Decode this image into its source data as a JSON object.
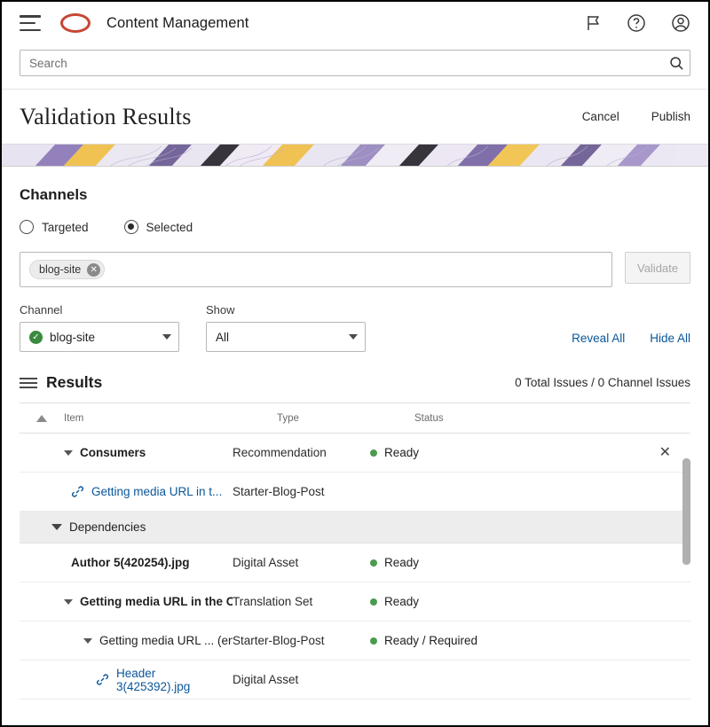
{
  "topbar": {
    "app_title": "Content Management",
    "menu_icon": "hamburger-icon",
    "logo_icon": "oracle-logo-icon",
    "icons": [
      "flag-icon",
      "help-icon",
      "user-account-icon"
    ]
  },
  "search": {
    "placeholder": "Search",
    "value": "",
    "icon": "search-icon"
  },
  "page": {
    "title": "Validation Results",
    "cancel_label": "Cancel",
    "publish_label": "Publish"
  },
  "channels": {
    "heading": "Channels",
    "radios": [
      {
        "label": "Targeted",
        "checked": false
      },
      {
        "label": "Selected",
        "checked": true
      }
    ],
    "chips": [
      {
        "label": "blog-site",
        "remove_icon": "chip-remove-icon"
      }
    ],
    "validate_label": "Validate",
    "channel_field_label": "Channel",
    "channel_value": "blog-site",
    "channel_status_icon": "check-circle-icon",
    "show_field_label": "Show",
    "show_value": "All",
    "reveal_all_label": "Reveal All",
    "hide_all_label": "Hide All"
  },
  "results": {
    "icon": "list-icon",
    "title": "Results",
    "issues_summary": "0 Total Issues / 0 Channel Issues",
    "columns": {
      "sort_icon": "sort-ascending-icon",
      "item": "Item",
      "type": "Type",
      "status": "Status"
    },
    "rows": [
      {
        "kind": "item",
        "indent": 1,
        "twisty": "expanded",
        "bold": true,
        "item": "Consumers",
        "type": "Recommendation",
        "status": "Ready",
        "status_dot": "#4a9b4f",
        "close_icon": "close-icon"
      },
      {
        "kind": "item",
        "indent": 2,
        "twisty": "none",
        "link_icon": "link-chain-icon",
        "link": true,
        "item": "Getting media URL in t...",
        "type": "Starter-Blog-Post",
        "status": "",
        "status_dot": ""
      },
      {
        "kind": "group",
        "indent": 0,
        "twisty": "expanded",
        "item": "Dependencies",
        "type": "",
        "status": "",
        "status_dot": ""
      },
      {
        "kind": "item",
        "indent": 2,
        "twisty": "none",
        "bold": true,
        "item": "Author 5(420254).jpg",
        "type": "Digital Asset",
        "status": "Ready",
        "status_dot": "#4a9b4f"
      },
      {
        "kind": "item",
        "indent": 1,
        "twisty": "expanded",
        "bold": true,
        "item": "Getting media URL in the Co...",
        "type": "Translation Set",
        "status": "Ready",
        "status_dot": "#4a9b4f"
      },
      {
        "kind": "item",
        "indent": 3,
        "twisty": "expanded",
        "item": "Getting media URL ...   (en-US)",
        "type": "Starter-Blog-Post",
        "status": "Ready / Required",
        "status_dot": "#4a9b4f"
      },
      {
        "kind": "item",
        "indent": 4,
        "twisty": "none",
        "link_icon": "link-chain-icon",
        "link": true,
        "item": "Header 3(425392).jpg",
        "type": "Digital Asset",
        "status": "",
        "status_dot": ""
      }
    ]
  },
  "colors": {
    "brand_red": "#c74634",
    "link_blue": "#0a5699",
    "status_green": "#4a9b4f",
    "group_bg": "#ededed"
  }
}
